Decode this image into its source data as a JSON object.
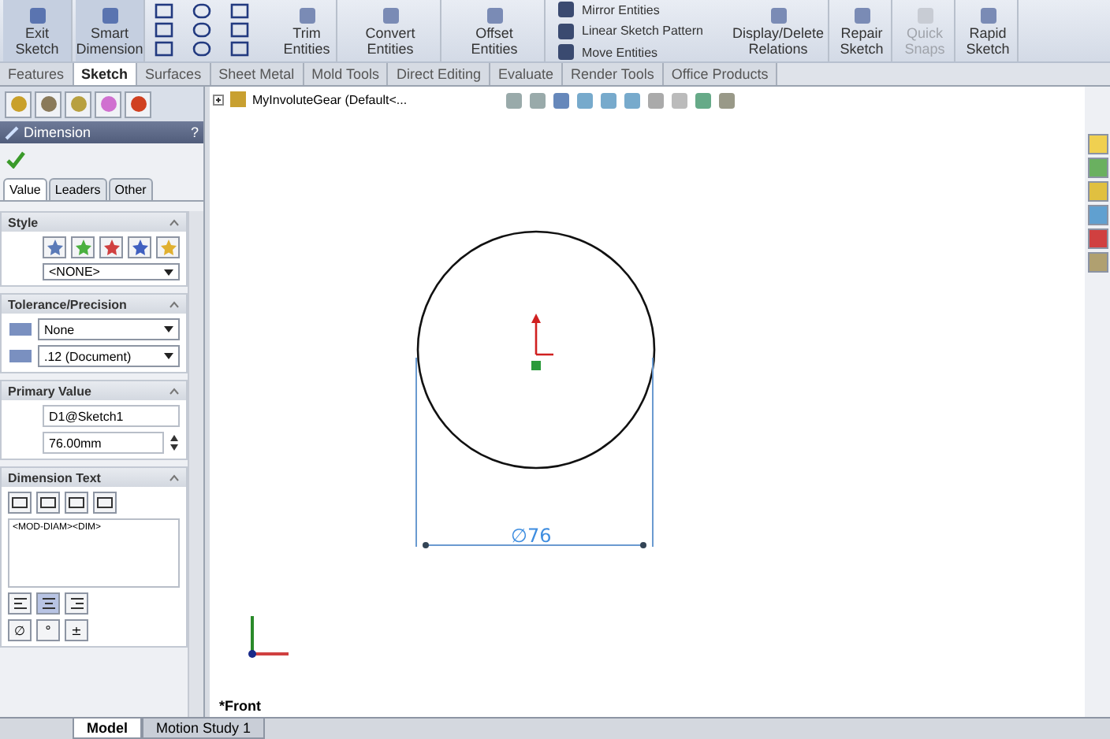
{
  "ribbon": {
    "tools": [
      {
        "label": "Exit\nSketch",
        "kind": "large"
      },
      {
        "label": "Smart\nDimension",
        "kind": "large"
      },
      {
        "kind": "grid"
      },
      {
        "label": "Trim\nEntities",
        "kind": "medium",
        "disabled": false
      },
      {
        "label": "Convert\nEntities",
        "kind": "medium",
        "disabled": false
      },
      {
        "label": "Offset\nEntities",
        "kind": "medium",
        "disabled": false
      },
      {
        "kind": "stack",
        "items": [
          "Mirror Entities",
          "Linear Sketch Pattern",
          "Move Entities"
        ]
      },
      {
        "label": "Display/Delete\nRelations",
        "kind": "medium",
        "disabled": false
      },
      {
        "label": "Repair\nSketch",
        "kind": "medium",
        "disabled": false
      },
      {
        "label": "Quick\nSnaps",
        "kind": "medium",
        "disabled": true
      },
      {
        "label": "Rapid\nSketch",
        "kind": "medium",
        "disabled": false
      }
    ]
  },
  "tabs": [
    {
      "label": "Features",
      "selected": false
    },
    {
      "label": "Sketch",
      "selected": true
    },
    {
      "label": "Surfaces",
      "selected": false
    },
    {
      "label": "Sheet Metal",
      "selected": false
    },
    {
      "label": "Mold Tools",
      "selected": false
    },
    {
      "label": "Direct Editing",
      "selected": false
    },
    {
      "label": "Evaluate",
      "selected": false
    },
    {
      "label": "Render Tools",
      "selected": false
    },
    {
      "label": "Office Products",
      "selected": false
    }
  ],
  "property_manager": {
    "title": "Dimension",
    "help": "?",
    "tabs": [
      {
        "label": "Value",
        "selected": true
      },
      {
        "label": "Leaders",
        "selected": false
      },
      {
        "label": "Other",
        "selected": false
      }
    ],
    "style": {
      "title": "Style",
      "value": "<NONE>"
    },
    "tolerance": {
      "title": "Tolerance/Precision",
      "tolerance": "None",
      "precision": ".12 (Document)"
    },
    "primary_value": {
      "title": "Primary Value",
      "name": "D1@Sketch1",
      "value": "76.00mm"
    },
    "dimension_text": {
      "title": "Dimension Text",
      "text": "<MOD-DIAM><DIM>",
      "align": [
        {
          "kind": "left",
          "selected": false
        },
        {
          "kind": "center",
          "selected": true
        },
        {
          "kind": "right",
          "selected": false
        }
      ],
      "symbols": [
        "∅",
        "°",
        "±"
      ]
    }
  },
  "feature_tree": {
    "label": "MyInvoluteGear  (Default<..."
  },
  "canvas": {
    "dimension": "∅76",
    "view": "*Front"
  },
  "bottom_tabs": [
    {
      "label": "Model",
      "selected": true
    },
    {
      "label": "Motion Study 1",
      "selected": false
    }
  ]
}
